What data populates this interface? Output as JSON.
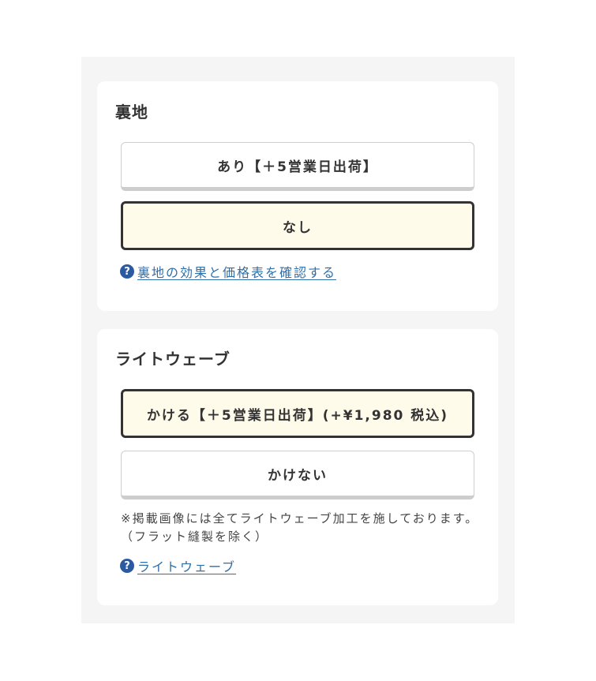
{
  "lining": {
    "title": "裏地",
    "options": [
      {
        "label": "あり【＋5営業日出荷】",
        "selected": false
      },
      {
        "label": "なし",
        "selected": true
      }
    ],
    "help_link": "裏地の効果と価格表を確認する"
  },
  "light_wave": {
    "title": "ライトウェーブ",
    "options": [
      {
        "label": "かける【＋5営業日出荷】(+¥1,980 税込)",
        "selected": true
      },
      {
        "label": "かけない",
        "selected": false
      }
    ],
    "note": "※掲載画像には全てライトウェーブ加工を施しております。（フラット縫製を除く）",
    "help_link": "ライトウェーブ"
  },
  "icons": {
    "help_icon_glyph": "?"
  },
  "colors": {
    "selected_bg": "#fffbea",
    "selected_border": "#333333",
    "link": "#2f6fa8",
    "panel_bg": "#f5f5f5"
  }
}
